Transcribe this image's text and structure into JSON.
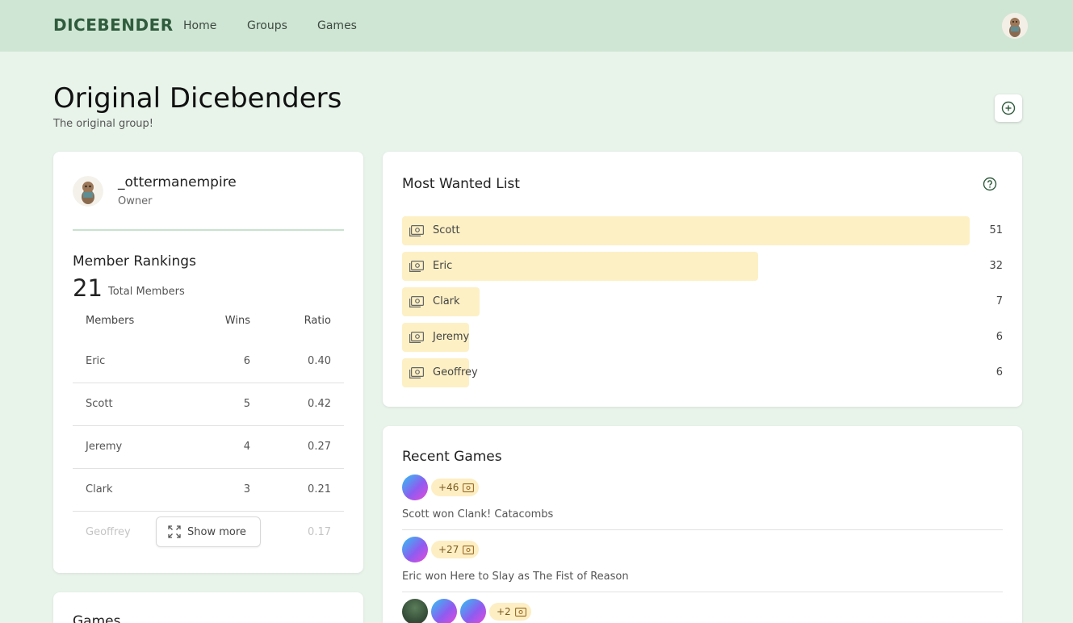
{
  "nav": {
    "logo": "DICEBENDER",
    "links": [
      "Home",
      "Groups",
      "Games"
    ]
  },
  "page": {
    "title": "Original Dicebenders",
    "subtitle": "The original group!"
  },
  "owner": {
    "name": "_ottermanempire",
    "role": "Owner"
  },
  "rankings": {
    "title": "Member Rankings",
    "count": "21",
    "count_label": "Total Members",
    "headers": [
      "Members",
      "Wins",
      "Ratio"
    ],
    "rows": [
      {
        "name": "Eric",
        "wins": "6",
        "ratio": "0.40"
      },
      {
        "name": "Scott",
        "wins": "5",
        "ratio": "0.42"
      },
      {
        "name": "Jeremy",
        "wins": "4",
        "ratio": "0.27"
      },
      {
        "name": "Clark",
        "wins": "3",
        "ratio": "0.21"
      },
      {
        "name": "Geoffrey",
        "wins": "",
        "ratio": "0.17"
      }
    ],
    "show_more": "Show more"
  },
  "wanted": {
    "title": "Most Wanted List",
    "items": [
      {
        "name": "Scott",
        "value": "51",
        "fraction": 1.0
      },
      {
        "name": "Eric",
        "value": "32",
        "fraction": 0.627
      },
      {
        "name": "Clark",
        "value": "7",
        "fraction": 0.137
      },
      {
        "name": "Jeremy",
        "value": "6",
        "fraction": 0.118
      },
      {
        "name": "Geoffrey",
        "value": "6",
        "fraction": 0.118
      }
    ]
  },
  "recent": {
    "title": "Recent Games",
    "items": [
      {
        "points": "+46",
        "text": "Scott won Clank! Catacombs"
      },
      {
        "points": "+27",
        "text": "Eric won Here to Slay as The Fist of Reason"
      },
      {
        "points": "+2",
        "text": ""
      }
    ]
  },
  "games": {
    "title": "Games"
  },
  "colors": {
    "navbar": "#d0e6d5",
    "background": "#e8f3ea",
    "bar": "#fdf0c5",
    "logo": "#2f5c3c"
  }
}
